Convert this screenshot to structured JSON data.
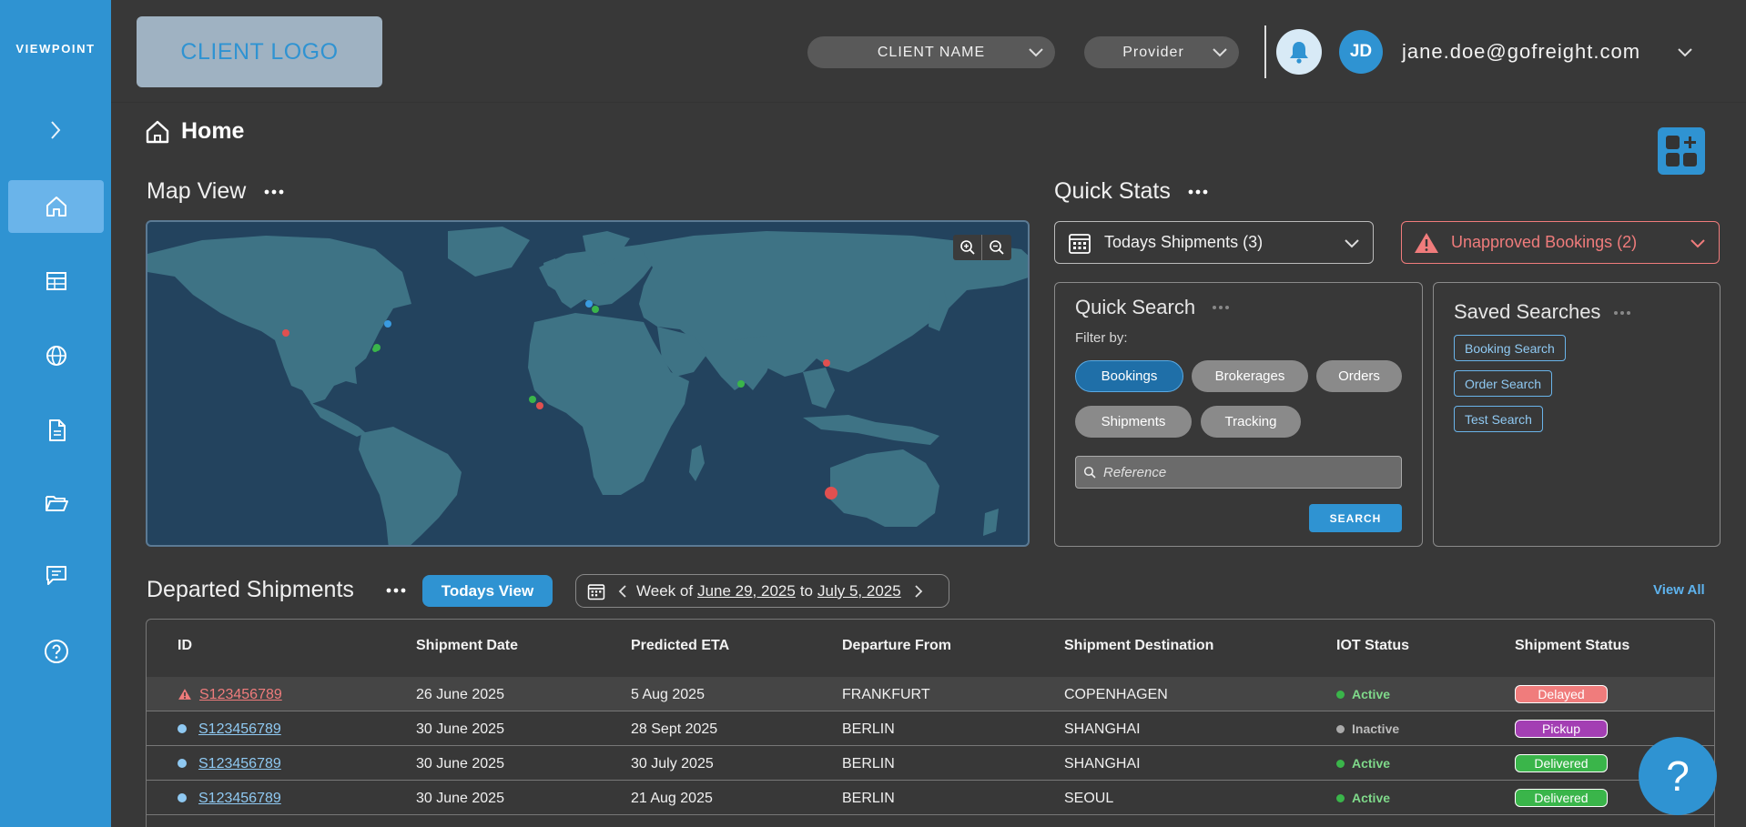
{
  "sidebar": {
    "brand": "VIEWPOINT",
    "items": [
      {
        "icon": "home-icon"
      },
      {
        "icon": "table-icon"
      },
      {
        "icon": "globe-icon"
      },
      {
        "icon": "document-icon"
      },
      {
        "icon": "folder-icon"
      },
      {
        "icon": "chat-icon"
      },
      {
        "icon": "help-circle-icon"
      }
    ],
    "accent_color": "#2f93d2"
  },
  "header": {
    "client_logo": "CLIENT LOGO",
    "client_select": "CLIENT NAME",
    "provider_select": "Provider",
    "avatar_initials": "JD",
    "user_email": "jane.doe@gofreight.com"
  },
  "page": {
    "title": "Home"
  },
  "map_view": {
    "title": "Map View",
    "markers": [
      {
        "color": "#e05050"
      },
      {
        "color": "#3a9be0"
      },
      {
        "color": "#3ab54a"
      },
      {
        "color": "#3ab54a"
      },
      {
        "color": "#3a9be0"
      },
      {
        "color": "#3ab54a"
      },
      {
        "color": "#3ab54a"
      },
      {
        "color": "#e05050"
      },
      {
        "color": "#3ab54a"
      },
      {
        "color": "#e05050"
      },
      {
        "color": "#e05050"
      }
    ]
  },
  "quick_stats": {
    "title": "Quick Stats",
    "todays_shipments": "Todays Shipments (3)",
    "unapproved_bookings": "Unapproved Bookings (2)"
  },
  "quick_search": {
    "title": "Quick Search",
    "filter_label": "Filter by:",
    "filters": [
      "Bookings",
      "Brokerages",
      "Orders",
      "Shipments",
      "Tracking"
    ],
    "active_filter": "Bookings",
    "reference_placeholder": "Reference",
    "search_label": "SEARCH"
  },
  "saved_searches": {
    "title": "Saved Searches",
    "items": [
      "Booking Search",
      "Order Search",
      "Test Search"
    ]
  },
  "departed": {
    "title": "Departed Shipments",
    "todays_view": "Todays View",
    "week_prefix": "Week of",
    "week_start": "June 29, 2025",
    "week_to": "to",
    "week_end": "July 5, 2025",
    "view_all": "View All",
    "columns": [
      "ID",
      "Shipment Date",
      "Predicted ETA",
      "Departure From",
      "Shipment Destination",
      "IOT Status",
      "Shipment Status"
    ],
    "rows": [
      {
        "id": "S123456789",
        "date": "26 June 2025",
        "eta": "5 Aug 2025",
        "from": "FRANKFURT",
        "to": "COPENHAGEN",
        "iot": "Active",
        "status": "Delayed",
        "alert": true
      },
      {
        "id": "S123456789",
        "date": "30 June 2025",
        "eta": "28 Sept 2025",
        "from": "BERLIN",
        "to": "SHANGHAI",
        "iot": "Inactive",
        "status": "Pickup",
        "alert": false
      },
      {
        "id": "S123456789",
        "date": "30 June 2025",
        "eta": "30 July 2025",
        "from": "BERLIN",
        "to": "SHANGHAI",
        "iot": "Active",
        "status": "Delivered",
        "alert": false
      },
      {
        "id": "S123456789",
        "date": "30 June 2025",
        "eta": "21 Aug 2025",
        "from": "BERLIN",
        "to": "SEOUL",
        "iot": "Active",
        "status": "Delivered",
        "alert": false
      }
    ]
  },
  "help_fab": "?"
}
